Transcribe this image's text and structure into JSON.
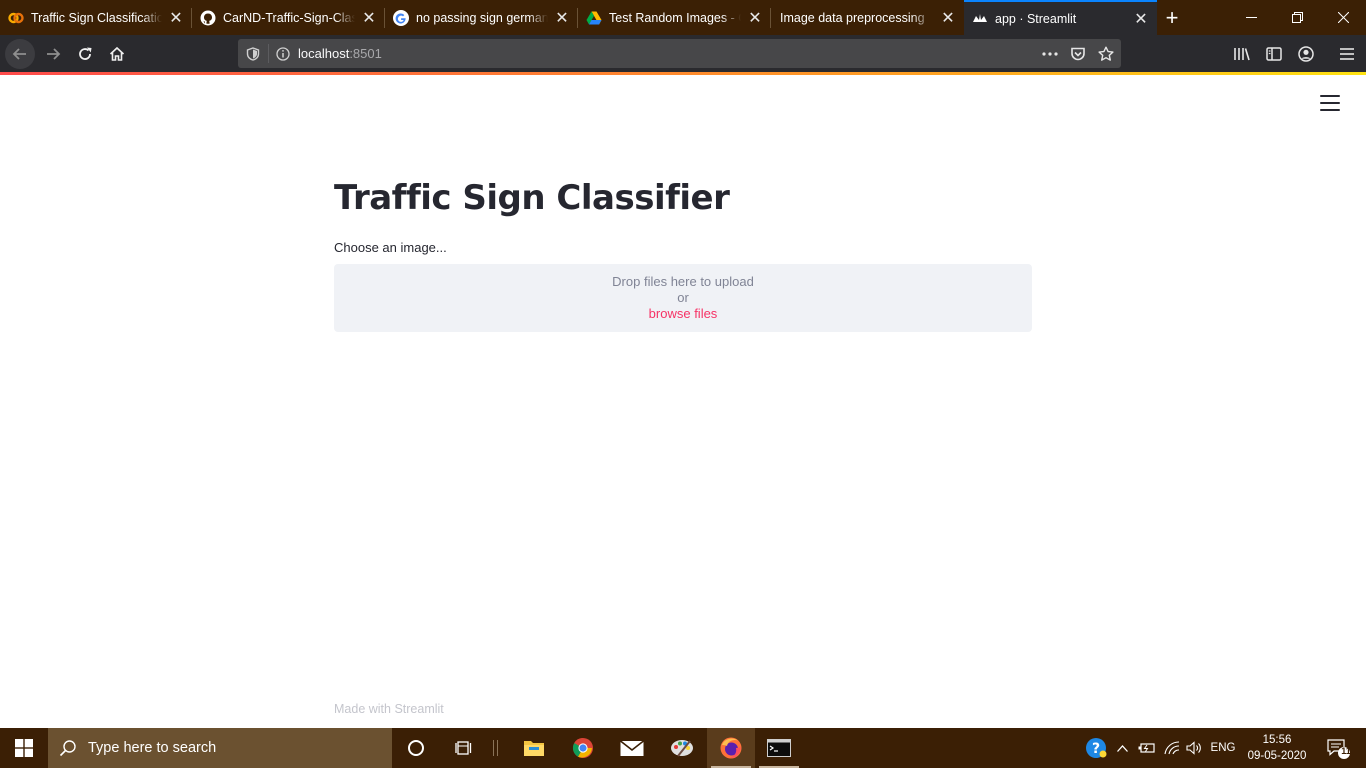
{
  "browser": {
    "tabs": [
      {
        "label": "Traffic Sign Classification",
        "favicon": "colab-icon"
      },
      {
        "label": "CarND-Traffic-Sign-Class",
        "favicon": "github-icon"
      },
      {
        "label": "no passing sign german",
        "favicon": "google-icon"
      },
      {
        "label": "Test Random Images - Go",
        "favicon": "google-drive-icon"
      },
      {
        "label": "Image data preprocessing",
        "favicon": ""
      },
      {
        "label": "app · Streamlit",
        "favicon": "streamlit-icon"
      }
    ],
    "active_tab_index": 5,
    "url_host": "localhost",
    "url_port": ":8501",
    "colors": {
      "tabstrip": "#3b2005",
      "active_tab": "#2a2a2e",
      "accent": "#0a84ff"
    }
  },
  "page": {
    "title": "Traffic Sign Classifier",
    "uploader": {
      "label": "Choose an image...",
      "drop_text": "Drop files here to upload",
      "or_text": "or",
      "browse_text": "browse files"
    },
    "footer": "Made with Streamlit",
    "colors": {
      "primary": "#f63366",
      "text": "#262730",
      "dropzone_bg": "#f0f2f6"
    }
  },
  "taskbar": {
    "search_placeholder": "Type here to search",
    "language": "ENG",
    "time": "15:56",
    "date": "09-05-2020",
    "notification_count": "11",
    "apps": [
      "cortana-icon",
      "task-view-icon",
      "file-explorer-icon",
      "chrome-icon",
      "mail-icon",
      "paint-icon",
      "firefox-icon",
      "terminal-icon"
    ]
  }
}
